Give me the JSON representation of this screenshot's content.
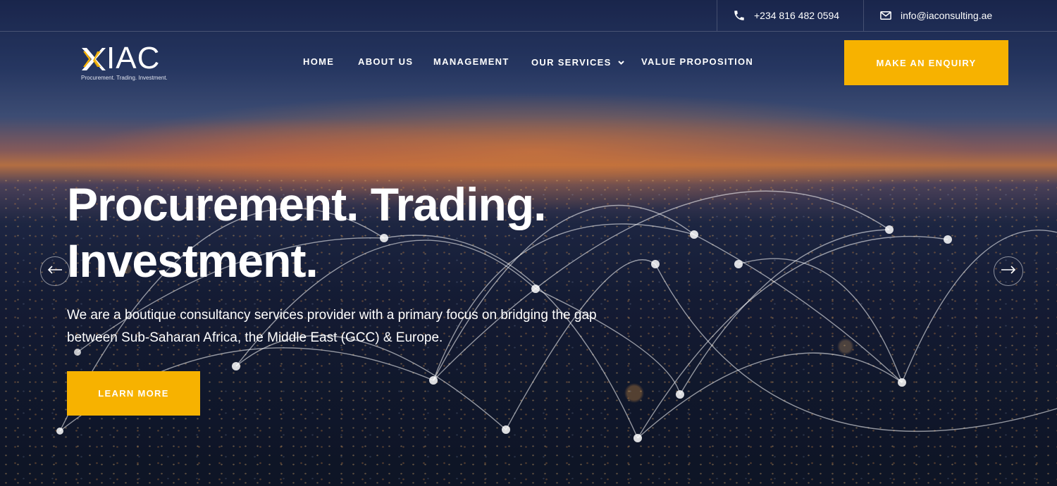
{
  "topbar": {
    "phone": "+234 816 482 0594",
    "email": "info@iaconsulting.ae"
  },
  "brand": {
    "name": "IAC",
    "tagline": "Procurement. Trading. Investment.",
    "accent_color": "#f7b200"
  },
  "nav": {
    "items": [
      "HOME",
      "ABOUT US",
      "MANAGEMENT",
      "OUR SERVICES",
      "VALUE PROPOSITION"
    ],
    "enquiry_label": "MAKE AN ENQUIRY"
  },
  "hero": {
    "headline_line1": "Procurement. Trading.",
    "headline_line2": "Investment.",
    "description": "We are a boutique consultancy services provider with a primary focus on bridging the gap between Sub-Saharan Africa, the Middle East (GCC) & Europe.",
    "cta_label": "LEARN MORE"
  },
  "icons": {
    "phone": "phone-icon",
    "email": "envelope-icon",
    "dropdown": "chevron-down-icon",
    "prev": "arrow-left-icon",
    "next": "arrow-right-icon"
  }
}
